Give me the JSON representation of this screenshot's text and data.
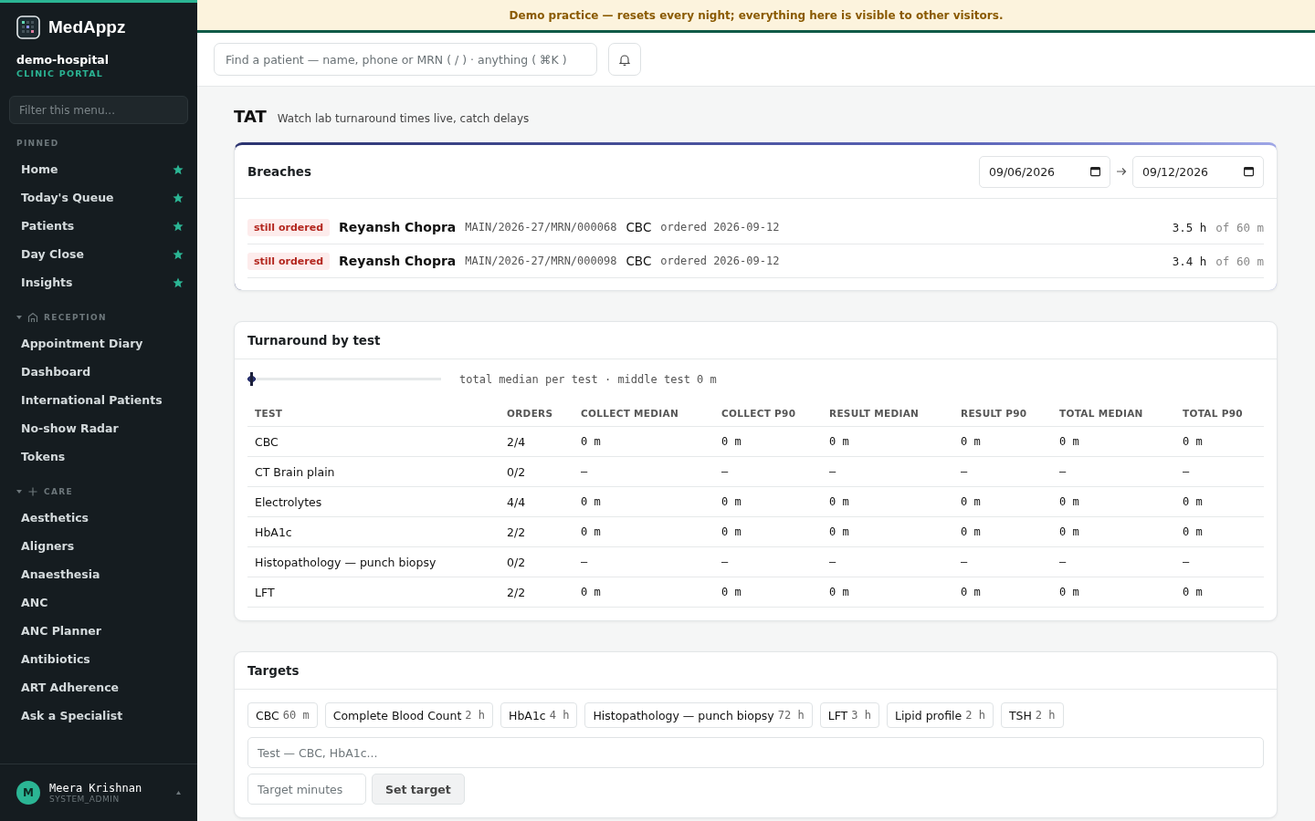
{
  "sidebar": {
    "brand": "MedAppz",
    "tenant": "demo-hospital",
    "portal": "CLINIC PORTAL",
    "filter": {
      "placeholder": "Filter this menu..."
    },
    "sections": [
      {
        "title": "PINNED",
        "kind": "pinned",
        "items": [
          {
            "label": "Home",
            "pinned": true
          },
          {
            "label": "Today's Queue",
            "pinned": true
          },
          {
            "label": "Patients",
            "pinned": true
          },
          {
            "label": "Day Close",
            "pinned": true
          },
          {
            "label": "Insights",
            "pinned": true
          }
        ]
      },
      {
        "title": "RECEPTION",
        "kind": "group",
        "expanded": true,
        "items": [
          {
            "label": "Appointment Diary"
          },
          {
            "label": "Dashboard"
          },
          {
            "label": "International Patients"
          },
          {
            "label": "No-show Radar"
          },
          {
            "label": "Tokens"
          }
        ]
      },
      {
        "title": "CARE",
        "kind": "group",
        "expanded": true,
        "items": [
          {
            "label": "Aesthetics"
          },
          {
            "label": "Aligners"
          },
          {
            "label": "Anaesthesia"
          },
          {
            "label": "ANC"
          },
          {
            "label": "ANC Planner"
          },
          {
            "label": "Antibiotics"
          },
          {
            "label": "ART Adherence"
          },
          {
            "label": "Ask a Specialist"
          }
        ]
      }
    ],
    "user": {
      "initial": "M",
      "name": "Meera Krishnan",
      "role": "SYSTEM_ADMIN"
    }
  },
  "banner": "Demo practice — resets every night; everything here is visible to other visitors.",
  "search": {
    "placeholder": "Find a patient — name, phone or MRN ( / ) · anything ( ⌘K )"
  },
  "page": {
    "title": "TAT",
    "subtitle": "Watch lab turnaround times live, catch delays"
  },
  "breaches": {
    "title": "Breaches",
    "date_from": "09/06/2026",
    "date_to": "09/12/2026",
    "rows": [
      {
        "status": "still ordered",
        "patient": "Reyansh Chopra",
        "mrn": "MAIN/2026-27/MRN/000068",
        "test": "CBC",
        "ordered": "ordered 2026-09-12",
        "elapsed": "3.5 h",
        "target": "of 60 m"
      },
      {
        "status": "still ordered",
        "patient": "Reyansh Chopra",
        "mrn": "MAIN/2026-27/MRN/000098",
        "test": "CBC",
        "ordered": "ordered 2026-09-12",
        "elapsed": "3.4 h",
        "target": "of 60 m"
      }
    ]
  },
  "turnaround": {
    "title": "Turnaround by test",
    "slider": {
      "level": 0
    },
    "caption": "total median per test · middle test 0 m",
    "columns": [
      "TEST",
      "ORDERS",
      "COLLECT MEDIAN",
      "COLLECT P90",
      "RESULT MEDIAN",
      "RESULT P90",
      "TOTAL MEDIAN",
      "TOTAL P90"
    ],
    "rows": [
      [
        "CBC",
        "2/4",
        "0 m",
        "0 m",
        "0 m",
        "0 m",
        "0 m",
        "0 m"
      ],
      [
        "CT Brain plain",
        "0/2",
        "—",
        "—",
        "—",
        "—",
        "—",
        "—"
      ],
      [
        "Electrolytes",
        "4/4",
        "0 m",
        "0 m",
        "0 m",
        "0 m",
        "0 m",
        "0 m"
      ],
      [
        "HbA1c",
        "2/2",
        "0 m",
        "0 m",
        "0 m",
        "0 m",
        "0 m",
        "0 m"
      ],
      [
        "Histopathology — punch biopsy",
        "0/2",
        "—",
        "—",
        "—",
        "—",
        "—",
        "—"
      ],
      [
        "LFT",
        "2/2",
        "0 m",
        "0 m",
        "0 m",
        "0 m",
        "0 m",
        "0 m"
      ]
    ]
  },
  "targets": {
    "title": "Targets",
    "chips": [
      {
        "test": "CBC",
        "value": "60 m"
      },
      {
        "test": "Complete Blood Count",
        "value": "2 h"
      },
      {
        "test": "HbA1c",
        "value": "4 h"
      },
      {
        "test": "Histopathology — punch biopsy",
        "value": "72 h"
      },
      {
        "test": "LFT",
        "value": "3 h"
      },
      {
        "test": "Lipid profile",
        "value": "2 h"
      },
      {
        "test": "TSH",
        "value": "2 h"
      }
    ],
    "test_field": {
      "placeholder": "Test — CBC, HbA1c..."
    },
    "minutes_field": {
      "placeholder": "Target minutes"
    },
    "button": "Set target"
  }
}
